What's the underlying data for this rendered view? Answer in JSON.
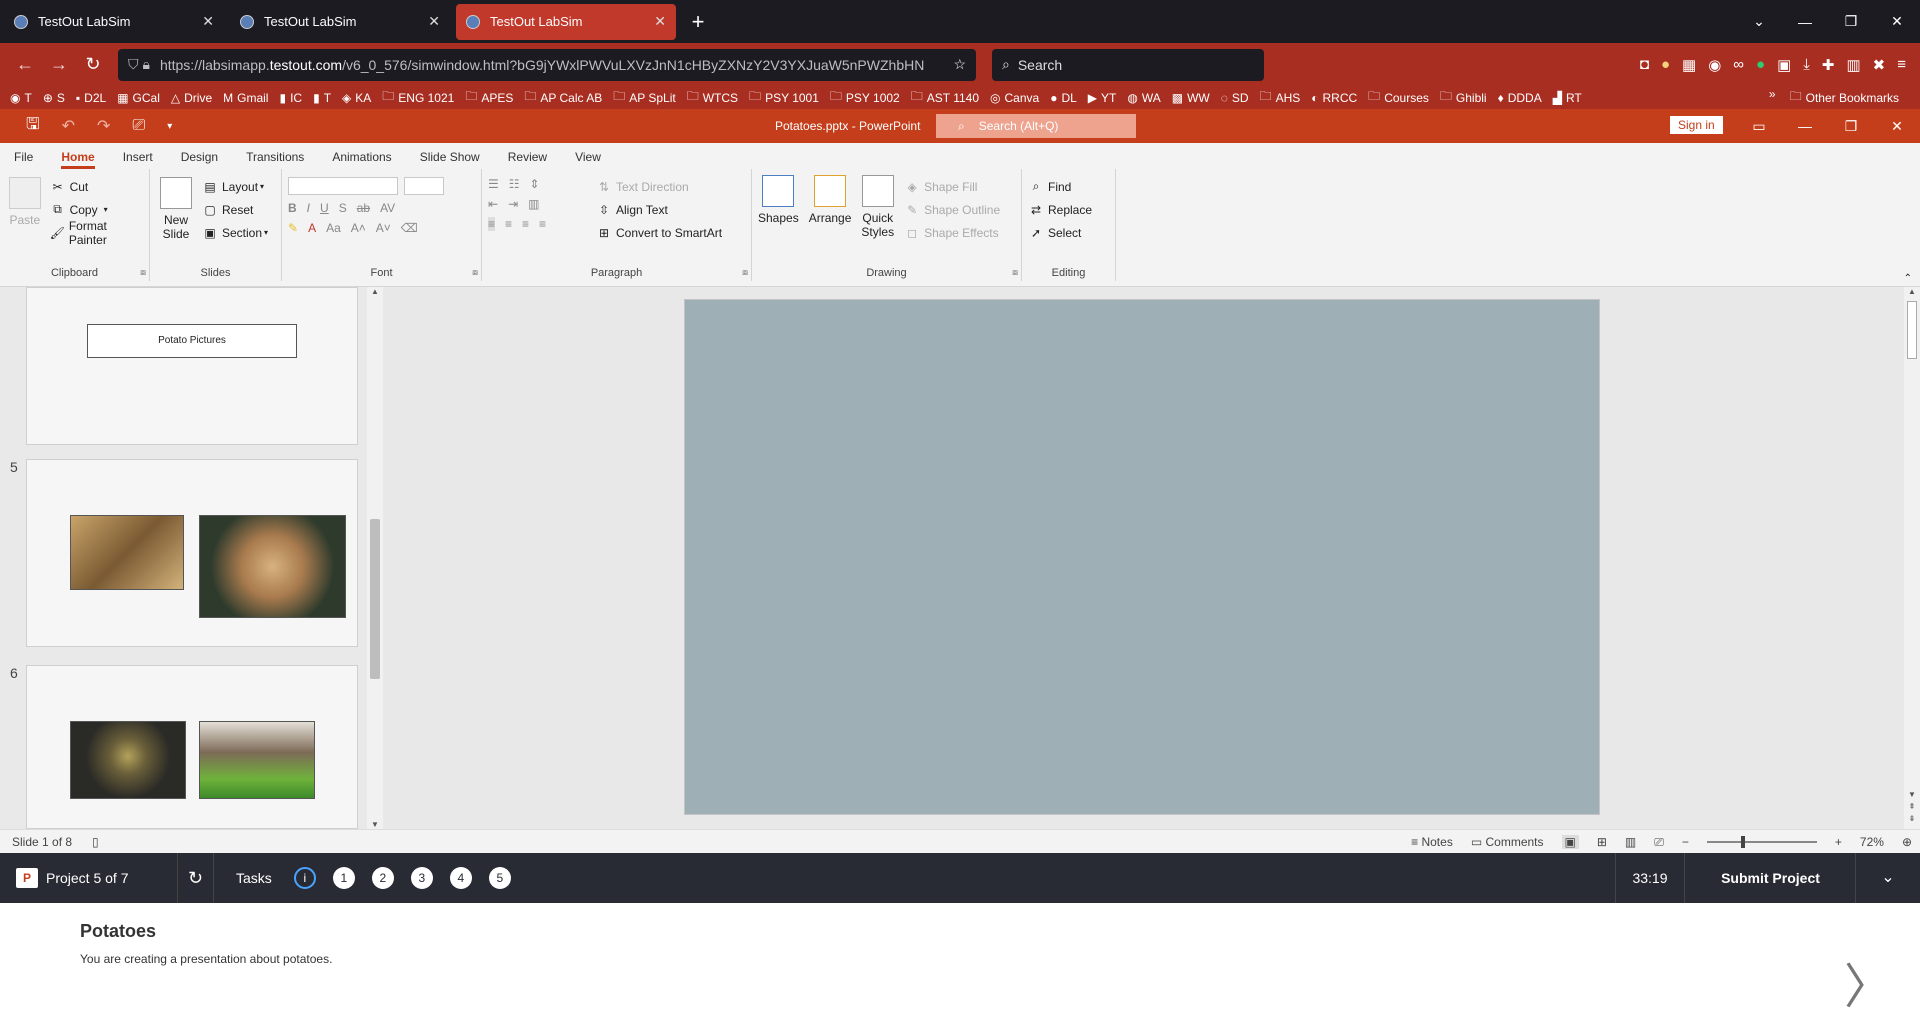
{
  "browser": {
    "tabs": [
      {
        "title": "TestOut LabSim",
        "active": false
      },
      {
        "title": "TestOut LabSim",
        "active": false
      },
      {
        "title": "TestOut LabSim",
        "active": true
      }
    ],
    "url_prefix": "https://labsimapp.",
    "url_domain": "testout.com",
    "url_rest": "/v6_0_576/simwindow.html?bG9jYWxlPWVuLXVzJnN1cHByZXNzY2V3YXJuaW5nPWZhbHN",
    "search_placeholder": "Search",
    "bookmarks": [
      "T",
      "S",
      "D2L",
      "GCal",
      "Drive",
      "Gmail",
      "IC",
      "T",
      "KA",
      "ENG 1021",
      "APES",
      "AP Calc AB",
      "AP SpLit",
      "WTCS",
      "PSY 1001",
      "PSY 1002",
      "AST 1140",
      "Canva",
      "DL",
      "YT",
      "WA",
      "WW",
      "SD",
      "AHS",
      "RRCC",
      "Courses",
      "Ghibli",
      "DDDA",
      "RT"
    ],
    "other_bookmarks": "Other Bookmarks",
    "accent": "#a82e22"
  },
  "ppt": {
    "doc_title": "Potatoes.pptx  -  PowerPoint",
    "search_placeholder": "Search (Alt+Q)",
    "sign_in": "Sign in",
    "tabs": [
      "File",
      "Home",
      "Insert",
      "Design",
      "Transitions",
      "Animations",
      "Slide Show",
      "Review",
      "View"
    ],
    "active_tab": "Home",
    "accent": "#c43e1c",
    "ribbon": {
      "clipboard": {
        "label": "Clipboard",
        "paste": "Paste",
        "cut": "Cut",
        "copy": "Copy",
        "format_painter": "Format Painter"
      },
      "slides": {
        "label": "Slides",
        "new_slide_1": "New",
        "new_slide_2": "Slide",
        "layout": "Layout",
        "reset": "Reset",
        "section": "Section"
      },
      "font": {
        "label": "Font"
      },
      "paragraph": {
        "label": "Paragraph",
        "text_direction": "Text Direction",
        "align_text": "Align Text",
        "convert_smartart": "Convert to SmartArt"
      },
      "drawing": {
        "label": "Drawing",
        "shapes": "Shapes",
        "arrange": "Arrange",
        "quick_styles_1": "Quick",
        "quick_styles_2": "Styles",
        "shape_fill": "Shape Fill",
        "shape_outline": "Shape Outline",
        "shape_effects": "Shape Effects"
      },
      "editing": {
        "label": "Editing",
        "find": "Find",
        "replace": "Replace",
        "select": "Select"
      }
    },
    "thumbnails": {
      "slide4_title": "Potato Pictures",
      "slide5_num": "5",
      "slide6_num": "6"
    },
    "status": {
      "slide_count": "Slide 1 of 8",
      "notes": "Notes",
      "comments": "Comments",
      "zoom": "72%"
    }
  },
  "labsim": {
    "project": "Project 5 of 7",
    "tasks_label": "Tasks",
    "task_numbers": [
      "1",
      "2",
      "3",
      "4",
      "5"
    ],
    "info": "i",
    "timer": "33:19",
    "submit": "Submit Project",
    "task_title": "Potatoes",
    "task_desc": "You are creating a presentation about potatoes."
  }
}
